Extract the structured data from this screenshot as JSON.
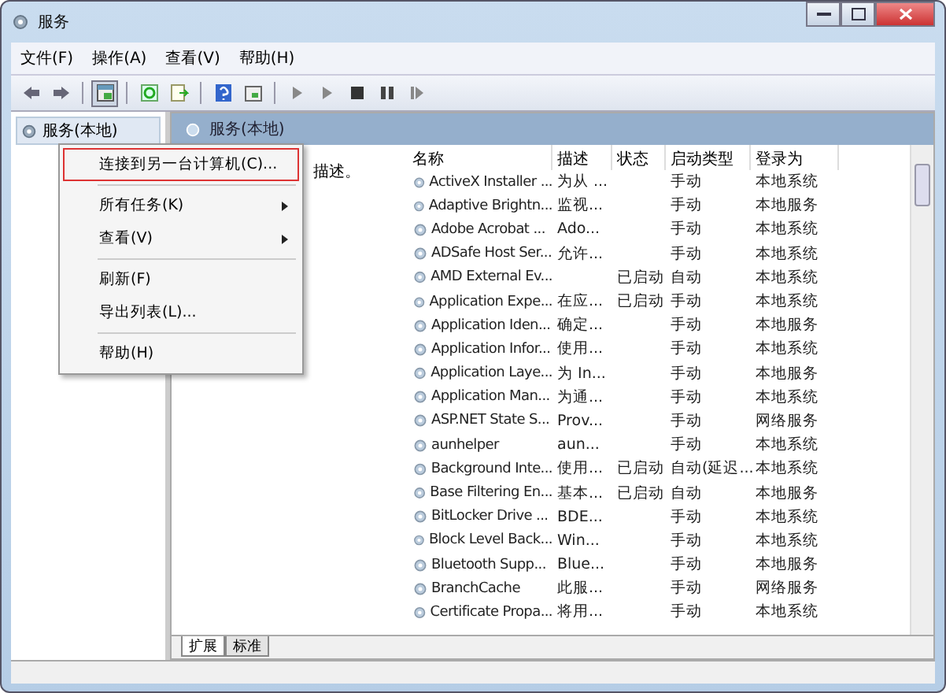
{
  "window": {
    "title": "服务"
  },
  "menu_bar": [
    "文件(F)",
    "操作(A)",
    "查看(V)",
    "帮助(H)"
  ],
  "toolbar": [
    [
      {
        "kind": "back",
        "pressed": false
      },
      {
        "kind": "forward",
        "pressed": false
      }
    ],
    [
      {
        "kind": "tree",
        "pressed": true
      }
    ],
    [
      {
        "kind": "refresh",
        "pressed": false
      },
      {
        "kind": "export",
        "pressed": false
      }
    ],
    [
      {
        "kind": "help",
        "pressed": false
      },
      {
        "kind": "view",
        "pressed": false
      }
    ],
    [
      {
        "kind": "play",
        "pressed": false
      },
      {
        "kind": "play",
        "pressed": false
      },
      {
        "kind": "stop",
        "pressed": false
      },
      {
        "kind": "pause",
        "pressed": false
      },
      {
        "kind": "resume",
        "pressed": false
      }
    ]
  ],
  "tree": {
    "items": [
      {
        "label": "服务(本地)",
        "selected": true
      }
    ]
  },
  "details": {
    "header": "服务(本地)",
    "description": "描述。"
  },
  "context_menu": [
    [
      {
        "label": "连接到另一台计算机(C)...",
        "selected": true,
        "submenu": false
      }
    ],
    [
      {
        "label": "所有任务(K)",
        "selected": false,
        "submenu": true
      },
      {
        "label": "查看(V)",
        "selected": false,
        "submenu": true
      }
    ],
    [
      {
        "label": "刷新(F)",
        "selected": false,
        "submenu": false
      },
      {
        "label": "导出列表(L)...",
        "selected": false,
        "submenu": false
      }
    ],
    [
      {
        "label": "帮助(H)",
        "selected": false,
        "submenu": false
      }
    ]
  ],
  "table": {
    "columns": [
      "名称",
      "描述",
      "状态",
      "启动类型",
      "登录为"
    ],
    "rows": [
      [
        "ActiveX Installer ...",
        "为从 ...",
        "",
        "手动",
        "本地系统"
      ],
      [
        "Adaptive Brightn...",
        "监视...",
        "",
        "手动",
        "本地服务"
      ],
      [
        "Adobe Acrobat ...",
        "Ado...",
        "",
        "手动",
        "本地系统"
      ],
      [
        "ADSafe Host Ser...",
        "允许...",
        "",
        "手动",
        "本地系统"
      ],
      [
        "AMD External Ev...",
        "",
        "已启动",
        "自动",
        "本地系统"
      ],
      [
        "Application Expe...",
        "在应...",
        "已启动",
        "手动",
        "本地系统"
      ],
      [
        "Application Iden...",
        "确定...",
        "",
        "手动",
        "本地服务"
      ],
      [
        "Application Infor...",
        "使用...",
        "",
        "手动",
        "本地系统"
      ],
      [
        "Application Laye...",
        "为 In...",
        "",
        "手动",
        "本地服务"
      ],
      [
        "Application Man...",
        "为通...",
        "",
        "手动",
        "本地系统"
      ],
      [
        "ASP.NET State S...",
        "Prov...",
        "",
        "手动",
        "网络服务"
      ],
      [
        "aunhelper",
        "aun...",
        "",
        "手动",
        "本地系统"
      ],
      [
        "Background Inte...",
        "使用...",
        "已启动",
        "自动(延迟...",
        "本地系统"
      ],
      [
        "Base Filtering En...",
        "基本...",
        "已启动",
        "自动",
        "本地服务"
      ],
      [
        "BitLocker Drive ...",
        "BDE...",
        "",
        "手动",
        "本地系统"
      ],
      [
        "Block Level Back...",
        "Win...",
        "",
        "手动",
        "本地系统"
      ],
      [
        "Bluetooth Supp...",
        "Blue...",
        "",
        "手动",
        "本地服务"
      ],
      [
        "BranchCache",
        "此服...",
        "",
        "手动",
        "网络服务"
      ],
      [
        "Certificate Propa...",
        "将用...",
        "",
        "手动",
        "本地系统"
      ]
    ]
  },
  "tabs": [
    {
      "label": "扩展",
      "selected": true
    },
    {
      "label": "标准",
      "selected": false
    }
  ]
}
